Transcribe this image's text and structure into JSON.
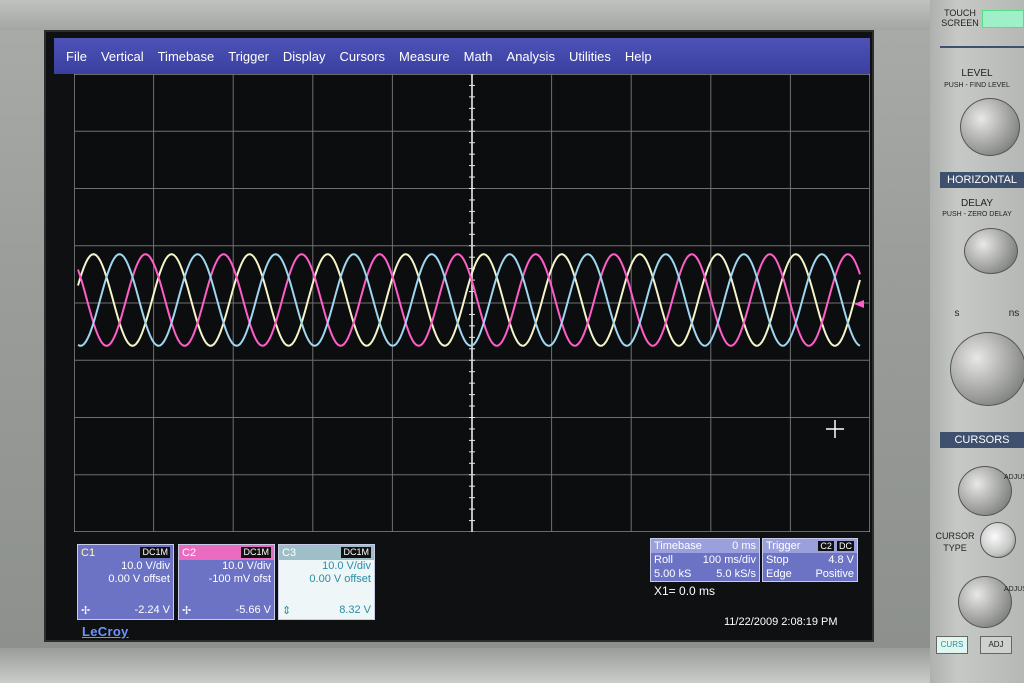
{
  "menu": [
    "File",
    "Vertical",
    "Timebase",
    "Trigger",
    "Display",
    "Cursors",
    "Measure",
    "Math",
    "Analysis",
    "Utilities",
    "Help"
  ],
  "channel_marker": "C3",
  "channels": [
    {
      "name": "C1",
      "coupling": "DC1M",
      "vdiv": "10.0 V/div",
      "offset": "0.00 V offset",
      "reading": "-2.24 V",
      "color": "#f5f5c8"
    },
    {
      "name": "C2",
      "coupling": "DC1M",
      "vdiv": "10.0 V/div",
      "offset": "-100 mV ofst",
      "reading": "-5.66 V",
      "color": "#ff5ec8"
    },
    {
      "name": "C3",
      "coupling": "DC1M",
      "vdiv": "10.0 V/div",
      "offset": "0.00 V offset",
      "reading": "8.32 V",
      "color": "#9fd6f0"
    }
  ],
  "timebase": {
    "label": "Timebase",
    "delay": "0 ms",
    "mode": "Roll",
    "tdiv": "100 ms/div",
    "samples": "5.00 kS",
    "rate": "5.0 kS/s"
  },
  "trigger": {
    "label": "Trigger",
    "source": "C2",
    "coupling": "DC",
    "mode": "Stop",
    "level": "4.8 V",
    "type": "Edge",
    "slope": "Positive"
  },
  "cursor_readout": "X1=  0.0 ms",
  "brand": "LeCroy",
  "datetime": "11/22/2009 2:08:19 PM",
  "panel": {
    "touch_screen": "TOUCH SCREEN",
    "level": "LEVEL",
    "level_sub": "PUSH - FIND LEVEL",
    "horizontal": "HORIZONTAL",
    "delay": "DELAY",
    "delay_sub": "PUSH - ZERO DELAY",
    "s_label": "s",
    "ns_label": "ns",
    "cursors": "CURSORS",
    "adjust_fine": "ADJUST FINE",
    "cursor_type": "CURSOR TYPE",
    "adjust_coarse": "ADJUST COARSE",
    "curs_btn": "CURS",
    "adj_btn": "ADJ"
  },
  "waveform": {
    "cycles_on_screen": 10.2,
    "amplitude_divs": 0.8
  }
}
